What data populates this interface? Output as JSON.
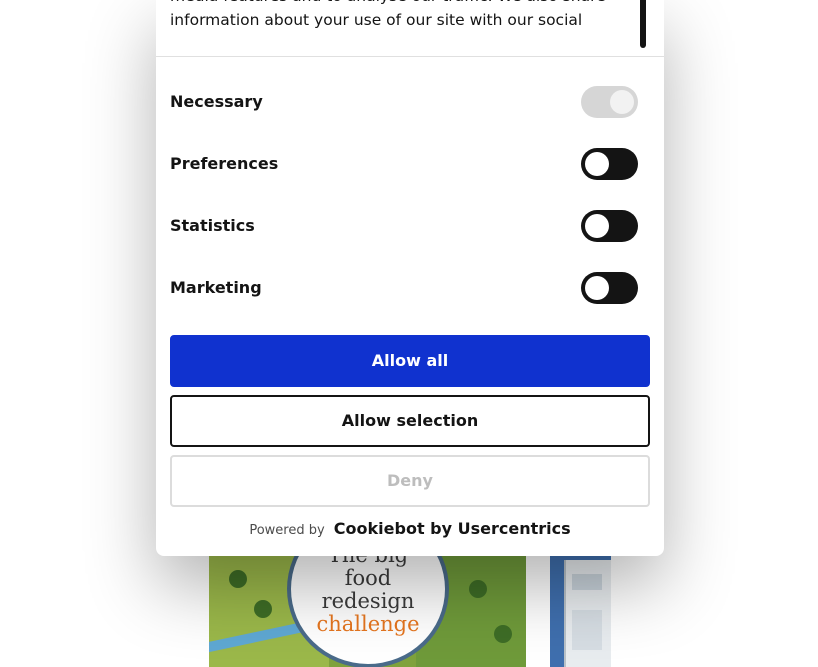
{
  "consent": {
    "intro_text": "media features and to analyse our traffic. We also share information about your use of our site with our social",
    "toggles": [
      {
        "label": "Necessary",
        "state": "on-disabled"
      },
      {
        "label": "Preferences",
        "state": "off"
      },
      {
        "label": "Statistics",
        "state": "off"
      },
      {
        "label": "Marketing",
        "state": "off"
      }
    ],
    "buttons": {
      "allow_all": "Allow all",
      "allow_selection": "Allow selection",
      "deny": "Deny"
    },
    "footer": {
      "powered_by": "Powered by",
      "brand": "Cookiebot by Usercentrics"
    }
  },
  "background": {
    "card_left_title": [
      "The big",
      "food",
      "redesign",
      "challenge"
    ]
  },
  "colors": {
    "accent": "#1032cf",
    "text": "#141414",
    "toggle_off": "#141414",
    "toggle_disabled": "#d6d6d6"
  }
}
